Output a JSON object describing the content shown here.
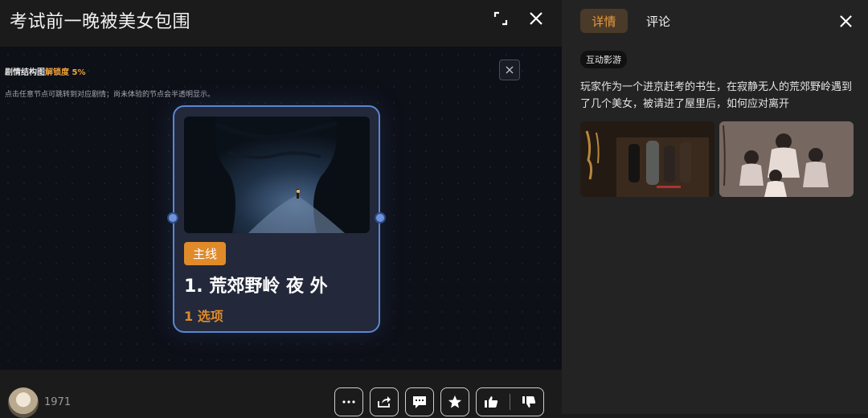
{
  "header": {
    "title": "考试前一晚被美女包围",
    "fullscreen_icon": "fullscreen-icon",
    "close_icon": "close-icon"
  },
  "story_map": {
    "title": "剧情结构图",
    "unlock_label": "解锁度",
    "unlock_percent": "5%",
    "unlock_value": 5,
    "hint": "点击任意节点可跳转到对应剧情；尚未体验的节点会半透明显示。",
    "close_icon": "close-icon",
    "node": {
      "tag": "主线",
      "title": "1. 荒郊野岭 夜 外",
      "options": "1 选项"
    }
  },
  "footer": {
    "count": "1971",
    "actions": [
      {
        "name": "more",
        "icon": "more-icon"
      },
      {
        "name": "share",
        "icon": "share-icon"
      },
      {
        "name": "comment",
        "icon": "comment-icon"
      },
      {
        "name": "favorite",
        "icon": "star-icon"
      },
      {
        "name": "like",
        "icon": "thumbs-up-icon"
      },
      {
        "name": "dislike",
        "icon": "thumbs-down-icon"
      }
    ]
  },
  "sidebar": {
    "tabs": [
      {
        "label": "详情",
        "active": true
      },
      {
        "label": "评论",
        "active": false
      }
    ],
    "badge": "互动影游",
    "description": "玩家作为一个进京赶考的书生，在寂静无人的荒郊野岭遇到了几个美女，被请进了屋里后，如何应对离开"
  },
  "colors": {
    "accent": "#e08a2a",
    "node_border": "#5b86d2",
    "canvas_bg": "#0e1018"
  }
}
